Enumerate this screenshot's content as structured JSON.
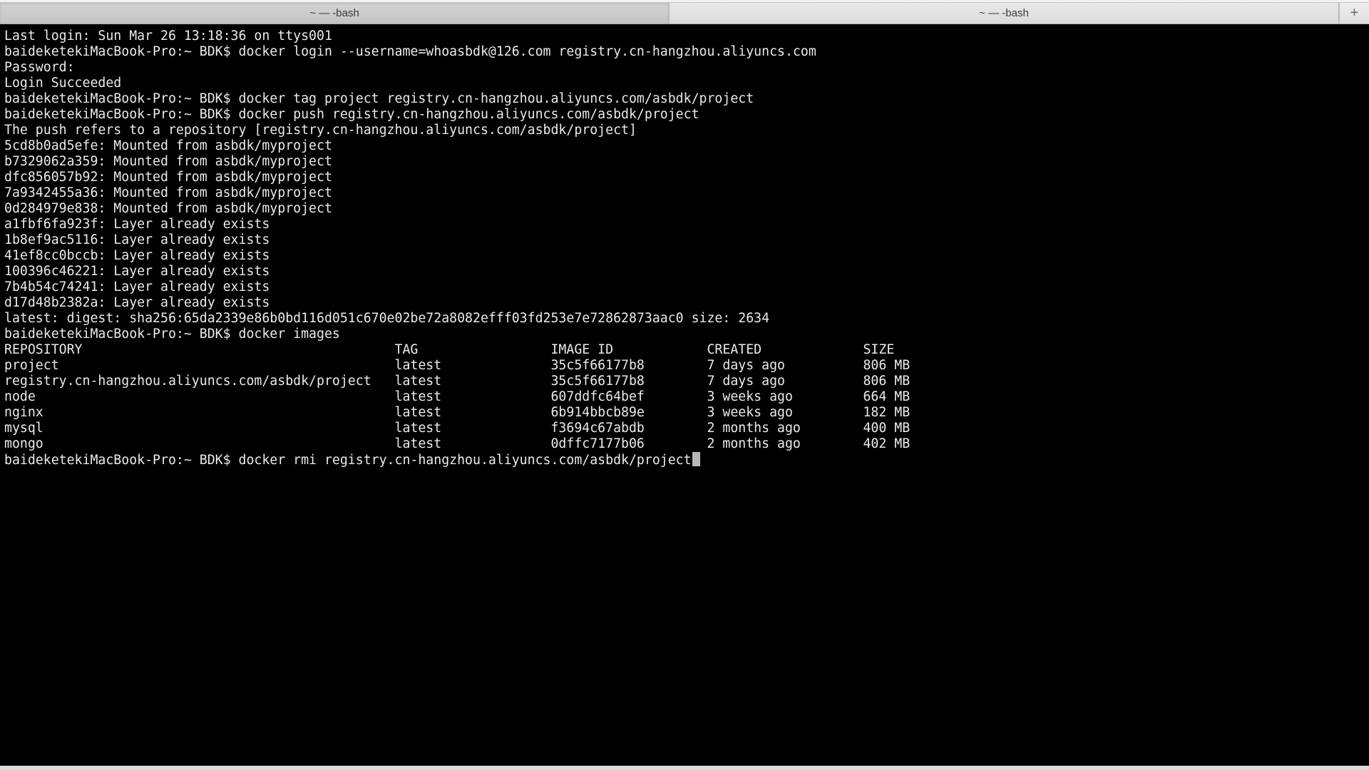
{
  "tabs": [
    {
      "label": "~ — -bash",
      "active": true
    },
    {
      "label": "~ — -bash",
      "active": false
    }
  ],
  "prompt_prefix": "baideketekiMacBook-Pro:~ BDK$ ",
  "session": {
    "last_login": "Last login: Sun Mar 26 13:18:36 on ttys001",
    "cmd_login": "docker login --username=whoasbdk@126.com registry.cn-hangzhou.aliyuncs.com",
    "password_label": "Password:",
    "login_succeeded": "Login Succeeded",
    "cmd_tag": "docker tag project registry.cn-hangzhou.aliyuncs.com/asbdk/project",
    "cmd_push": "docker push registry.cn-hangzhou.aliyuncs.com/asbdk/project",
    "push_refers": "The push refers to a repository [registry.cn-hangzhou.aliyuncs.com/asbdk/project]",
    "layers": [
      "5cd8b0ad5efe: Mounted from asbdk/myproject",
      "b7329062a359: Mounted from asbdk/myproject",
      "dfc856057b92: Mounted from asbdk/myproject",
      "7a9342455a36: Mounted from asbdk/myproject",
      "0d284979e838: Mounted from asbdk/myproject",
      "a1fbf6fa923f: Layer already exists",
      "1b8ef9ac5116: Layer already exists",
      "41ef8cc0bccb: Layer already exists",
      "100396c46221: Layer already exists",
      "7b4b54c74241: Layer already exists",
      "d17d48b2382a: Layer already exists"
    ],
    "digest_line": "latest: digest: sha256:65da2339e86b0bd116d051c670e02be72a8082efff03fd253e7e72862873aac0 size: 2634",
    "cmd_images": "docker images",
    "images_header": {
      "repo": "REPOSITORY",
      "tag": "TAG",
      "id": "IMAGE ID",
      "created": "CREATED",
      "size": "SIZE"
    },
    "images": [
      {
        "repo": "project",
        "tag": "latest",
        "id": "35c5f66177b8",
        "created": "7 days ago",
        "size": "806 MB"
      },
      {
        "repo": "registry.cn-hangzhou.aliyuncs.com/asbdk/project",
        "tag": "latest",
        "id": "35c5f66177b8",
        "created": "7 days ago",
        "size": "806 MB"
      },
      {
        "repo": "node",
        "tag": "latest",
        "id": "607ddfc64bef",
        "created": "3 weeks ago",
        "size": "664 MB"
      },
      {
        "repo": "nginx",
        "tag": "latest",
        "id": "6b914bbcb89e",
        "created": "3 weeks ago",
        "size": "182 MB"
      },
      {
        "repo": "mysql",
        "tag": "latest",
        "id": "f3694c67abdb",
        "created": "2 months ago",
        "size": "400 MB"
      },
      {
        "repo": "mongo",
        "tag": "latest",
        "id": "0dffc7177b06",
        "created": "2 months ago",
        "size": "402 MB"
      }
    ],
    "cmd_rmi": "docker rmi registry.cn-hangzhou.aliyuncs.com/asbdk/project"
  },
  "cols": {
    "repo": 50,
    "tag": 20,
    "id": 20,
    "created": 20
  }
}
